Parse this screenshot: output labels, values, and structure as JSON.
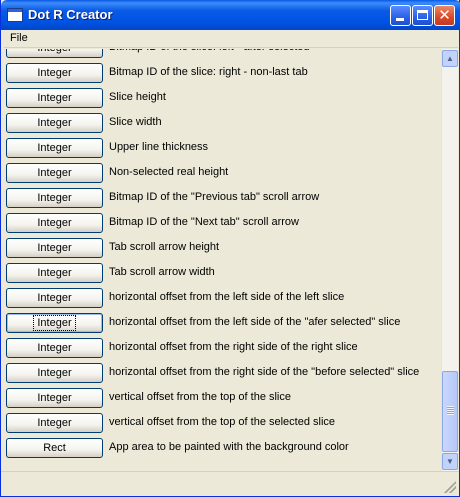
{
  "window": {
    "title": "Dot R Creator"
  },
  "menu": {
    "file": "File"
  },
  "rows": [
    {
      "button": "Integer",
      "desc": "Bitmap ID of the slice: left - after selected"
    },
    {
      "button": "Integer",
      "desc": "Bitmap ID of the slice: right - non-last tab"
    },
    {
      "button": "Integer",
      "desc": "Slice height"
    },
    {
      "button": "Integer",
      "desc": "Slice width"
    },
    {
      "button": "Integer",
      "desc": "Upper line thickness"
    },
    {
      "button": "Integer",
      "desc": "Non-selected real height"
    },
    {
      "button": "Integer",
      "desc": "Bitmap ID of the \"Previous tab\" scroll arrow"
    },
    {
      "button": "Integer",
      "desc": "Bitmap ID of the \"Next tab\" scroll arrow"
    },
    {
      "button": "Integer",
      "desc": "Tab scroll arrow height"
    },
    {
      "button": "Integer",
      "desc": "Tab scroll arrow width"
    },
    {
      "button": "Integer",
      "desc": "horizontal offset from the left side of the left slice"
    },
    {
      "button": "Integer",
      "desc": "horizontal offset from the left side of the \"afer selected\" slice"
    },
    {
      "button": "Integer",
      "desc": "horizontal offset from the right side of the right slice"
    },
    {
      "button": "Integer",
      "desc": "horizontal offset from the right side of the \"before selected\" slice"
    },
    {
      "button": "Integer",
      "desc": "vertical offset from the top of the slice"
    },
    {
      "button": "Integer",
      "desc": "vertical offset from the top of the selected slice"
    },
    {
      "button": "Rect",
      "desc": "App area to be painted with the background color"
    }
  ],
  "focused_row": 11,
  "icons": {
    "app": "window-icon",
    "minimize": "minimize-icon",
    "maximize": "maximize-icon",
    "close": "close-icon",
    "scroll_up": "scroll-up-arrow-icon",
    "scroll_down": "scroll-down-arrow-icon"
  },
  "colors": {
    "titlebar": "#0054e3",
    "close_button": "#d8482a",
    "window_bg": "#ece9d8"
  }
}
